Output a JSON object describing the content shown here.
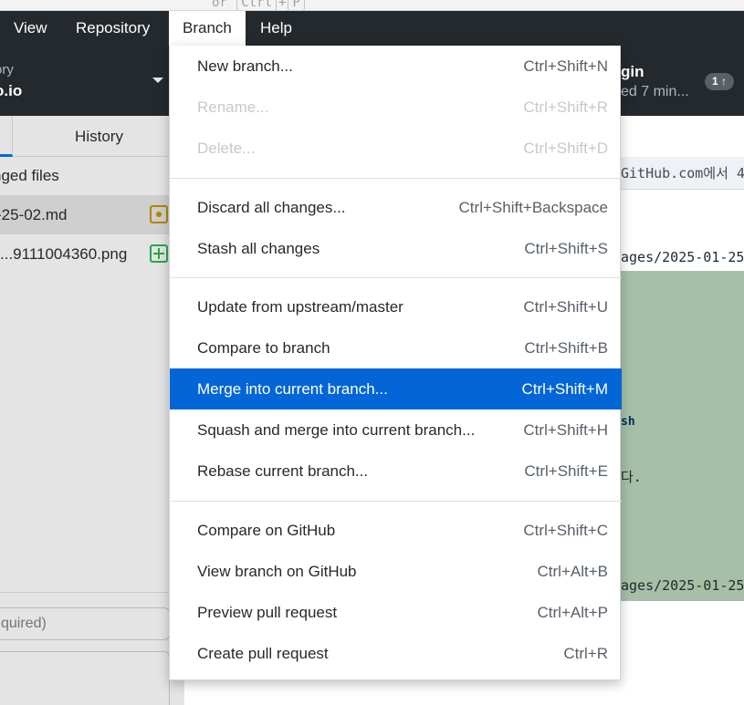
{
  "top_strip": {
    "ghost_prefix": "or",
    "ghost_key1": "Ctrl",
    "ghost_plus": "+",
    "ghost_key2": "P"
  },
  "menubar": {
    "items": [
      {
        "label": "View"
      },
      {
        "label": "Repository"
      },
      {
        "label": "Branch"
      },
      {
        "label": "Help"
      }
    ]
  },
  "toolbar": {
    "repo_caption": "ory",
    "repo_name": "o.io",
    "push_title": "gin",
    "push_sub": "ed 7 min...",
    "push_badge": "1 ↑"
  },
  "sidebar": {
    "tab_history": "History",
    "changed_header": "nged files",
    "files": [
      {
        "name": "-25-02.md",
        "status": "modified"
      },
      {
        "name": "...9111004360.png",
        "status": "added"
      }
    ],
    "summary_placeholder": "quired)"
  },
  "diff": {
    "header_text": "GitHub.com에서 4",
    "lines": [
      {
        "text": "ages/2025-01-25"
      },
      {
        "text": "sh"
      },
      {
        "text": "다."
      },
      {
        "text": "ages/2025-01-25"
      }
    ]
  },
  "branch_menu": {
    "items": [
      {
        "label": "New branch...",
        "shortcut": "Ctrl+Shift+N",
        "disabled": false
      },
      {
        "label": "Rename...",
        "shortcut": "Ctrl+Shift+R",
        "disabled": true
      },
      {
        "label": "Delete...",
        "shortcut": "Ctrl+Shift+D",
        "disabled": true
      },
      {
        "label": "Discard all changes...",
        "shortcut": "Ctrl+Shift+Backspace",
        "disabled": false
      },
      {
        "label": "Stash all changes",
        "shortcut": "Ctrl+Shift+S",
        "disabled": false
      },
      {
        "label": "Update from upstream/master",
        "shortcut": "Ctrl+Shift+U",
        "disabled": false
      },
      {
        "label": "Compare to branch",
        "shortcut": "Ctrl+Shift+B",
        "disabled": false
      },
      {
        "label": "Merge into current branch...",
        "shortcut": "Ctrl+Shift+M",
        "disabled": false,
        "highlighted": true
      },
      {
        "label": "Squash and merge into current branch...",
        "shortcut": "Ctrl+Shift+H",
        "disabled": false
      },
      {
        "label": "Rebase current branch...",
        "shortcut": "Ctrl+Shift+E",
        "disabled": false
      },
      {
        "label": "Compare on GitHub",
        "shortcut": "Ctrl+Shift+C",
        "disabled": false
      },
      {
        "label": "View branch on GitHub",
        "shortcut": "Ctrl+Alt+B",
        "disabled": false
      },
      {
        "label": "Preview pull request",
        "shortcut": "Ctrl+Alt+P",
        "disabled": false
      },
      {
        "label": "Create pull request",
        "shortcut": "Ctrl+R",
        "disabled": false
      }
    ]
  },
  "colors": {
    "menubar_bg": "#24292e",
    "highlight": "#0366d6",
    "added_bg": "#a6c0a8"
  }
}
